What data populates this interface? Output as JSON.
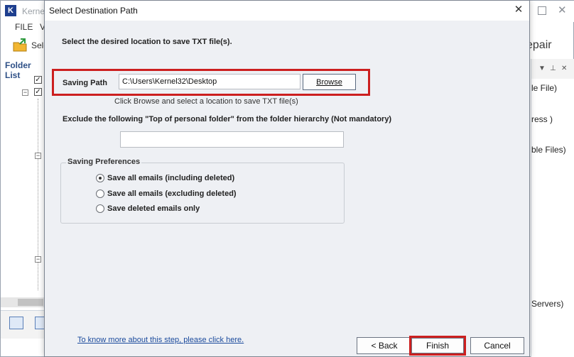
{
  "app": {
    "title_fragment": "Kerne",
    "menu": [
      "FILE",
      "V"
    ],
    "toolbar_label_fragment": "Sele",
    "repair_fragment": "epair",
    "folder_list_label": "Folder List",
    "right_pane_fragments": [
      "le File)",
      "ress )",
      "ble Files)",
      "Servers)"
    ]
  },
  "dialog": {
    "title": "Select Destination Path",
    "instruction": "Select the desired location to save TXT file(s).",
    "saving_path": {
      "label": "Saving Path",
      "value": "C:\\Users\\Kernel32\\Desktop",
      "browse_label": "Browse",
      "hint": "Click Browse and select a location to save TXT file(s)"
    },
    "exclude": {
      "label": "Exclude the following \"Top of personal folder\" from the folder hierarchy  (Not mandatory)",
      "value": ""
    },
    "preferences": {
      "legend": "Saving Preferences",
      "options": [
        {
          "label": "Save all emails (including deleted)",
          "checked": true
        },
        {
          "label": "Save all emails (excluding deleted)",
          "checked": false
        },
        {
          "label": "Save deleted emails only",
          "checked": false
        }
      ]
    },
    "help_link": "To know more about this step, please click here.",
    "buttons": {
      "back": "< Back",
      "finish": "Finish",
      "cancel": "Cancel"
    }
  },
  "colors": {
    "highlight": "#cc1f1f",
    "dialog_bg": "#eef0f4",
    "link": "#1a4a9c"
  }
}
